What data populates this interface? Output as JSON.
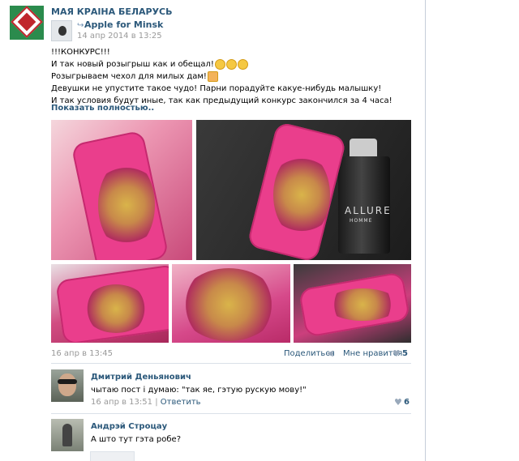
{
  "group": {
    "name": "МАЯ КРАІНА БЕЛАРУСЬ"
  },
  "repost": {
    "source_name": "Apple for Minsk",
    "date": "14 апр 2014 в 13:25",
    "icon": "repost-arrow-icon"
  },
  "post": {
    "lines": [
      "!!!КОНКУРС!!!",
      "И так новый розыгрыш как и обещал!",
      "Розыгрываем чехол для милых дам!",
      "Девушки не упустите такое чудо! Парни порадуйте какуе-нибудь малышку!",
      "И так условия будут иные, так как предыдущий конкурс закончился за 4 часа!"
    ],
    "show_more": "Показать полностью..",
    "date": "16 апр в 13:45",
    "share_label": "Поделиться",
    "like_label": "Мне нравится",
    "like_count": "5",
    "photo_brand": "ALLURE",
    "photo_brand_sub": "HOMME"
  },
  "comments": [
    {
      "author": "Дмитрий Деньянович",
      "text": "чытаю пост і думаю: \"так яе, гэтую рускую мову!\"",
      "date": "16 апр в 13:51",
      "separator": "|",
      "reply_label": "Ответить",
      "like_count": "6"
    },
    {
      "author": "Андрэй Строцау",
      "text": "А што тут гэта робе?"
    }
  ],
  "colors": {
    "link": "#2b587a",
    "muted": "#999999",
    "case_pink": "#ea3e8c"
  }
}
